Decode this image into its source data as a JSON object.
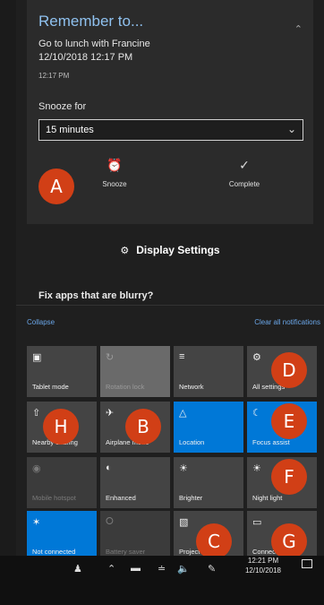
{
  "toast": {
    "title": "Remember to...",
    "body_line1": "Go to lunch with Francine",
    "body_line2": "12/10/2018 12:17 PM",
    "time": "12:17 PM",
    "snooze_label": "Snooze for",
    "snooze_value": "15 minutes",
    "actions": [
      {
        "label": "Snooze",
        "icon": "alarm-clock-icon"
      },
      {
        "label": "Complete",
        "icon": "checkmark-icon"
      }
    ]
  },
  "display_settings": {
    "label": "Display Settings",
    "icon": "gear-icon"
  },
  "fix_apps": {
    "label": "Fix apps that are blurry?"
  },
  "action_center": {
    "collapse": "Collapse",
    "clear_all": "Clear all notifications",
    "tiles": [
      {
        "label": "Tablet mode",
        "icon": "tablet-mode-icon",
        "state": "off"
      },
      {
        "label": "Rotation lock",
        "icon": "rotation-lock-icon",
        "state": "dim"
      },
      {
        "label": "Network",
        "icon": "network-icon",
        "state": "off"
      },
      {
        "label": "All settings",
        "icon": "gear-icon",
        "state": "off"
      },
      {
        "label": "Nearby sharing",
        "icon": "nearby-sharing-icon",
        "state": "off"
      },
      {
        "label": "Airplane mode",
        "icon": "airplane-icon",
        "state": "off"
      },
      {
        "label": "Location",
        "icon": "location-icon",
        "state": "on"
      },
      {
        "label": "Focus assist",
        "icon": "moon-icon",
        "state": "on"
      },
      {
        "label": "Mobile hotspot",
        "icon": "mobile-hotspot-icon",
        "state": "disabled"
      },
      {
        "label": "Enhanced",
        "icon": "enhanced-icon",
        "state": "off"
      },
      {
        "label": "Brighter",
        "icon": "brightness-icon",
        "state": "off"
      },
      {
        "label": "Night light",
        "icon": "night-light-icon",
        "state": "off"
      },
      {
        "label": "Not connected",
        "icon": "bluetooth-icon",
        "state": "on"
      },
      {
        "label": "Battery saver",
        "icon": "battery-saver-icon",
        "state": "disabled"
      },
      {
        "label": "Project",
        "icon": "project-icon",
        "state": "off"
      },
      {
        "label": "Connect",
        "icon": "connect-icon",
        "state": "off"
      }
    ]
  },
  "markers": [
    "A",
    "B",
    "C",
    "D",
    "E",
    "F",
    "G",
    "H"
  ],
  "taskbar": {
    "time": "12:21 PM",
    "date": "12/10/2018"
  },
  "colors": {
    "accent": "#0078d7",
    "marker": "#d13f16",
    "link": "#6aa6e8"
  }
}
